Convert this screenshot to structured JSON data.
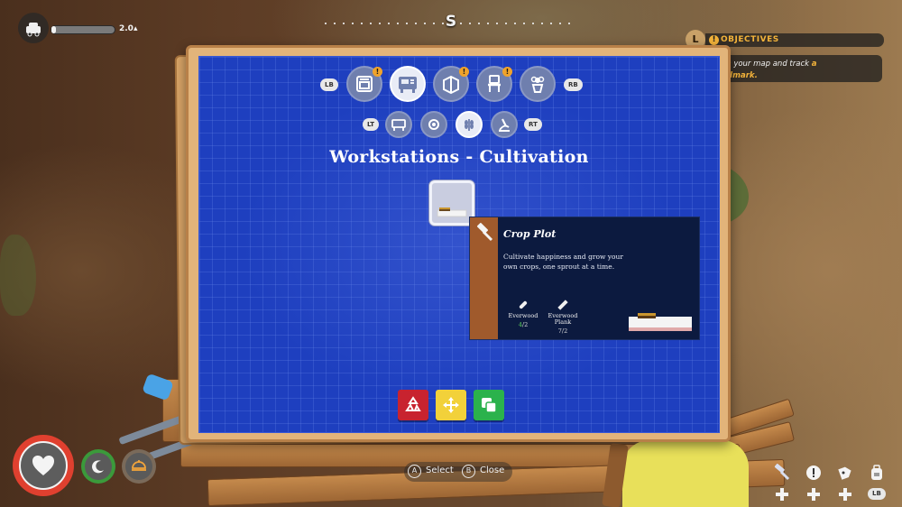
{
  "hud": {
    "weight_label": "2.0",
    "carry_fraction": 0.07
  },
  "compass": {
    "heading": "S"
  },
  "objectives": {
    "key_hint": "L",
    "title": "OBJECTIVES",
    "text_before": "en your map and track ",
    "text_highlight_1": "a",
    "text_highlight_2": "ndmark."
  },
  "blueprint": {
    "nav_left": "LB",
    "nav_right": "RB",
    "sub_nav_left": "LT",
    "sub_nav_right": "RT",
    "categories": [
      {
        "name": "furnace",
        "badge": "!"
      },
      {
        "name": "workstations",
        "badge": ""
      },
      {
        "name": "structures",
        "badge": "!"
      },
      {
        "name": "furniture",
        "badge": "!"
      },
      {
        "name": "decor",
        "badge": ""
      }
    ],
    "subcategories": [
      "general",
      "crafting",
      "cultivation",
      "science"
    ],
    "title": "Workstations - Cultivation"
  },
  "tooltip": {
    "title": "Crop Plot",
    "description": "Cultivate happiness and grow your own crops, one sprout at a time.",
    "materials": [
      {
        "name": "Everwood",
        "have": "4",
        "need": "/2"
      },
      {
        "name": "Everwood Plank",
        "have": "7",
        "need": "/2"
      }
    ]
  },
  "prompts": {
    "select_key": "A",
    "select_label": "Select",
    "close_key": "B",
    "close_label": "Close"
  },
  "bottom_right": {
    "lb_label": "LB"
  },
  "colors": {
    "blueprint": "#1e3fbf",
    "recycle": "#c8232f",
    "move": "#f2d13a",
    "copy": "#2bb24c",
    "accent": "#f3b33a",
    "health": "#e0402f"
  }
}
